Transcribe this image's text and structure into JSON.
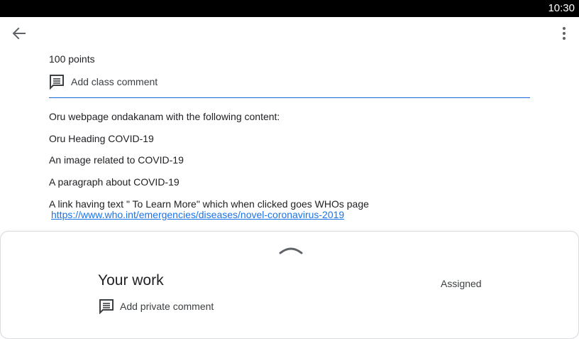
{
  "status_bar": {
    "time": "10:30"
  },
  "app_bar": {
    "back_icon": "arrow-back-icon",
    "more_icon": "more-vert-icon"
  },
  "assignment": {
    "points": "100 points",
    "class_comment_label": "Add class comment",
    "description": [
      "Oru webpage ondakanam with the following content:",
      "Oru Heading COVID-19",
      "An image related to COVID-19",
      "A paragraph about COVID-19",
      "A link having text \" To Learn More\" which when clicked goes WHOs page"
    ],
    "link": "https://www.who.int/emergencies/diseases/novel-coronavirus-2019"
  },
  "your_work": {
    "title": "Your work",
    "status": "Assigned",
    "private_comment_label": "Add private comment"
  },
  "colors": {
    "accent": "#1967d2",
    "link": "#1a73e8",
    "text": "#202124"
  }
}
